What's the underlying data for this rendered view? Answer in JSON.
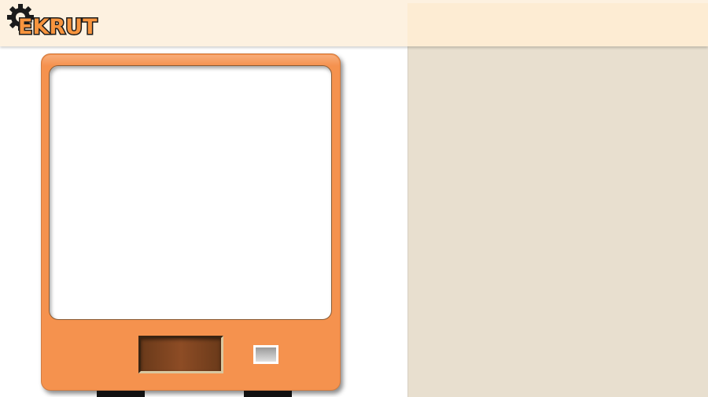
{
  "header": {
    "logo": {
      "text": "EKRUT",
      "icon": "gear-icon",
      "text_color": "#f7943e",
      "outline_color": "#1b1b1b"
    },
    "background_color": "#fdf1e0"
  },
  "side_panel": {
    "background_color": "#e8dfcf"
  },
  "machine": {
    "body_color": "#f5924e",
    "screen_color": "#ffffff",
    "slot_color": "#7a4020",
    "coin_button_icon": "coin-return-icon"
  }
}
